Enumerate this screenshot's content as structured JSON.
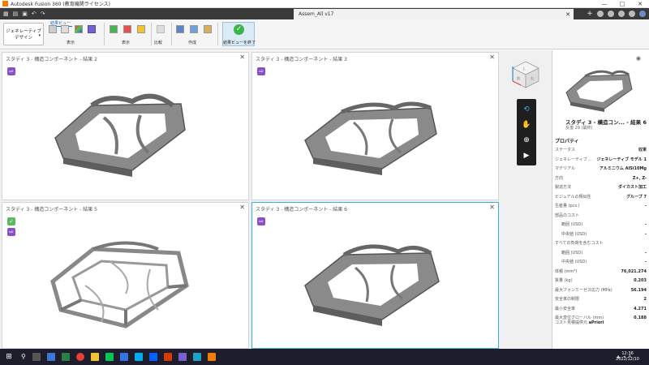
{
  "window": {
    "title": "Autodesk Fusion 360 (教育機関ライセンス)",
    "minimize": "—",
    "maximize": "□",
    "close": "✕"
  },
  "tabs": {
    "document": "Assem_All v17",
    "close": "✕",
    "new_tab": "+"
  },
  "ribbon": {
    "workspace": "ジェネレーティブ デザイン",
    "active_tab": "結果ビュー",
    "groups": [
      "表示",
      "表示",
      "比較",
      "作成"
    ],
    "finish": "結果ビューを終了"
  },
  "panels": [
    {
      "title": "スタディ 3 - 構造コンポーネント - 結果 2",
      "close": "✕"
    },
    {
      "title": "スタディ 3 - 構造コンポーネント - 結果 3",
      "close": "✕"
    },
    {
      "title": "スタディ 3 - 構造コンポーネント - 結果 5",
      "close": "✕"
    },
    {
      "title": "スタディ 3 - 構造コンポーネント - 結果 6",
      "close": "✕"
    }
  ],
  "viewcube": {
    "top_label": "上",
    "front_label": "前",
    "right_label": "右"
  },
  "properties": {
    "study_title": "スタディ 3 - 構造コン... - 結果 6",
    "study_sub": "反復 29 (最終)",
    "section": "プロパティ",
    "rows": [
      {
        "label": "ステータス",
        "value": "収束",
        "kind": "normal"
      },
      {
        "label": "ジェネレーティブ ...",
        "value": "ジェネレーティブ モデル 1",
        "kind": "normal"
      },
      {
        "label": "マテリアル",
        "value": "アルミニウム AlSi10Mg",
        "kind": "normal"
      },
      {
        "label": "方向",
        "value": "Z+, Z-",
        "kind": "normal"
      },
      {
        "label": "製造方法",
        "value": "ダイカスト加工",
        "kind": "normal"
      },
      {
        "label": "ビジュアルの類似性",
        "value": "グループ 7",
        "kind": "normal"
      },
      {
        "label": "生産量 (pcs.)",
        "value": "-",
        "kind": "normal"
      },
      {
        "label": "部品のコスト",
        "value": "",
        "kind": "hdr"
      },
      {
        "label": "範囲 (USD)",
        "value": "-",
        "kind": "sub"
      },
      {
        "label": "中央値 (USD)",
        "value": "-",
        "kind": "sub"
      },
      {
        "label": "すべての負荷を含むコスト",
        "value": "",
        "kind": "hdr"
      },
      {
        "label": "範囲 (USD)",
        "value": "-",
        "kind": "sub"
      },
      {
        "label": "中央値 (USD)",
        "value": "-",
        "kind": "sub"
      },
      {
        "label": "体積 (mm³)",
        "value": "76,021.274",
        "kind": "normal"
      },
      {
        "label": "質量 (kg)",
        "value": "0.203",
        "kind": "normal"
      },
      {
        "label": "最大フォンミーゼス応力 (MPa)",
        "value": "56.194",
        "kind": "normal"
      },
      {
        "label": "安全率の制限",
        "value": "2",
        "kind": "normal"
      },
      {
        "label": "最小安全率",
        "value": "4.271",
        "kind": "normal"
      },
      {
        "label": "最大変位グローバル (mm)",
        "value": "0.188",
        "kind": "normal"
      }
    ],
    "cost_label": "コスト見積提供元",
    "cost_provider": "aPriori"
  },
  "taskbar": {
    "time": "12:36",
    "date": "2022/12/10",
    "lang": "A"
  },
  "colors": {
    "accent": "#1c6fb9",
    "panel_selected": "#3ab4d6",
    "badge_purple": "#8b4fc9",
    "badge_green": "#5cb85c",
    "finish_green": "#3ab54a"
  }
}
